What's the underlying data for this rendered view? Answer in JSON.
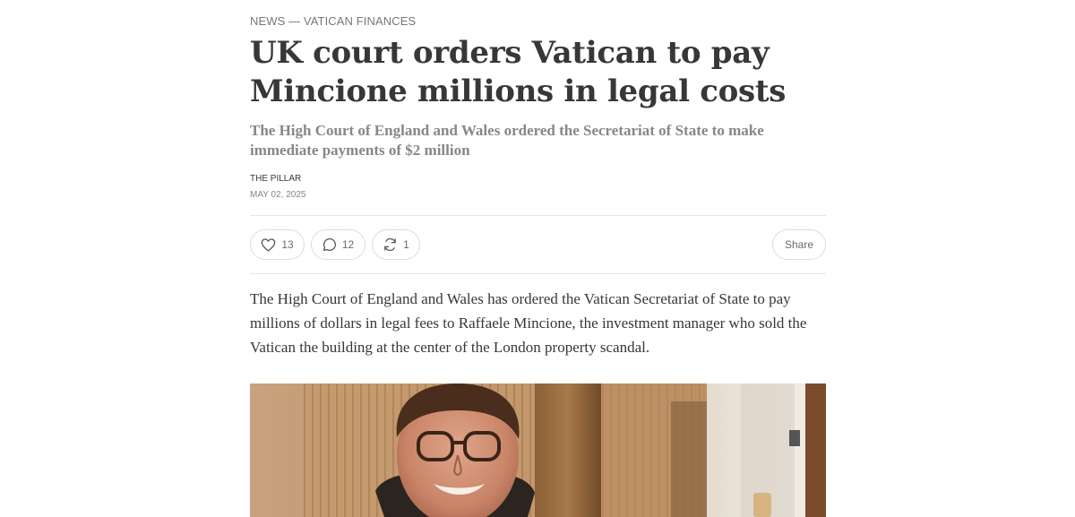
{
  "article": {
    "category": "NEWS — VATICAN FINANCES",
    "title": "UK court orders Vatican to pay Mincione millions in legal costs",
    "subtitle": "The High Court of England and Wales ordered the Secretariat of State to make immediate payments of $2 million",
    "author": "THE PILLAR",
    "date": "MAY 02, 2025",
    "body": "The High Court of England and Wales has ordered the Vatican Secretariat of State to pay millions of dollars in legal fees to Raffaele Mincione, the investment manager who sold the Vatican the building at the center of the London property scandal."
  },
  "actions": {
    "likes": "13",
    "comments": "12",
    "restacks": "1",
    "share_label": "Share",
    "icons": [
      "heart-icon",
      "comment-icon",
      "restack-icon"
    ]
  }
}
